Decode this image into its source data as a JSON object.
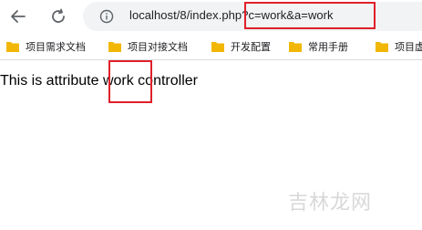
{
  "browser": {
    "url": "localhost/8/index.php?c=work&a=work",
    "icons": {
      "back": "arrow-left-icon",
      "reload": "reload-icon",
      "info": "info-icon",
      "bookmark_folder": "folder-icon"
    },
    "bookmarks": [
      "项目需求文档",
      "项目对接文档",
      "开发配置",
      "常用手册",
      "项目虚"
    ]
  },
  "page": {
    "text_before": "This is attribute ",
    "highlighted_word": "work",
    "text_after": " controller"
  },
  "watermark": "吉林龙网",
  "colors": {
    "annotation_red": "#e0202a",
    "folder_yellow": "#f2b705",
    "omnibox_bg": "#f1f3f4"
  }
}
